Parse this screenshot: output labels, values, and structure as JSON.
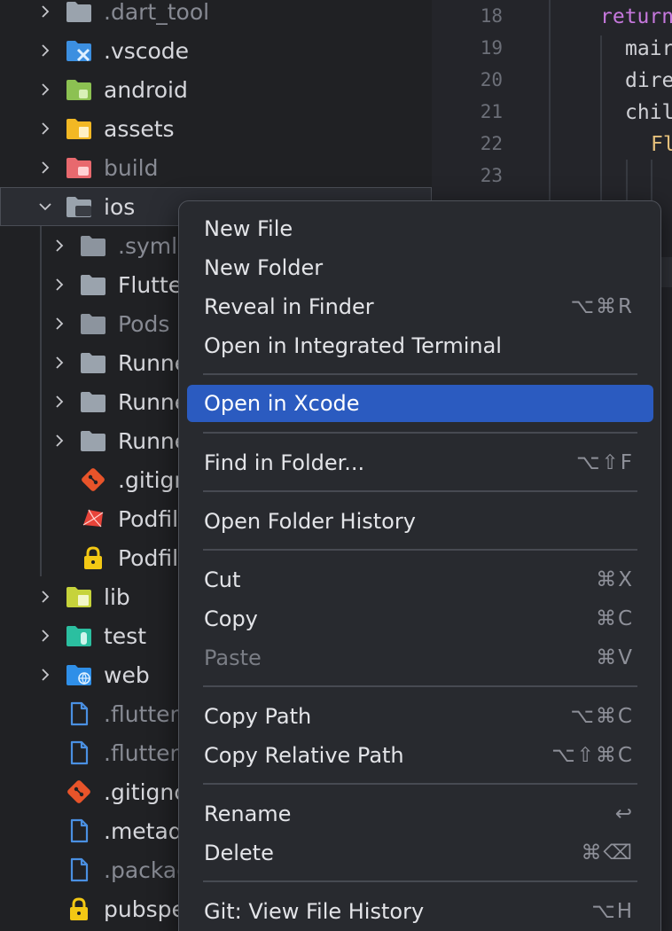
{
  "explorer": {
    "items": [
      {
        "label": ".dart_tool",
        "icon": "folder-icon",
        "expandable": true,
        "dim": true
      },
      {
        "label": ".vscode",
        "icon": "folder-vscode-icon",
        "expandable": true,
        "dim": false
      },
      {
        "label": "android",
        "icon": "folder-android-icon",
        "expandable": true,
        "dim": false
      },
      {
        "label": "assets",
        "icon": "folder-assets-icon",
        "expandable": true,
        "dim": false
      },
      {
        "label": "build",
        "icon": "folder-build-icon",
        "expandable": true,
        "dim": true
      },
      {
        "label": "ios",
        "icon": "folder-ios-icon",
        "expandable": true,
        "expanded": true,
        "dim": false
      },
      {
        "label": ".symli",
        "icon": "folder-icon",
        "expandable": true,
        "dim": true
      },
      {
        "label": "Flutte",
        "icon": "folder-icon",
        "expandable": true,
        "dim": false
      },
      {
        "label": "Pods",
        "icon": "folder-icon",
        "expandable": true,
        "dim": true
      },
      {
        "label": "Runne",
        "icon": "folder-icon",
        "expandable": true,
        "dim": false
      },
      {
        "label": "Runne",
        "icon": "folder-icon",
        "expandable": true,
        "dim": false
      },
      {
        "label": "Runne",
        "icon": "folder-icon",
        "expandable": true,
        "dim": false
      },
      {
        "label": ".gitign",
        "icon": "git-icon",
        "expandable": false,
        "dim": false
      },
      {
        "label": "Podfil",
        "icon": "ruby-icon",
        "expandable": false,
        "dim": false
      },
      {
        "label": "Podfil",
        "icon": "lock-icon",
        "expandable": false,
        "dim": false
      },
      {
        "label": "lib",
        "icon": "folder-lib-icon",
        "expandable": true,
        "dim": false
      },
      {
        "label": "test",
        "icon": "folder-test-icon",
        "expandable": true,
        "dim": false
      },
      {
        "label": "web",
        "icon": "folder-web-icon",
        "expandable": true,
        "dim": false
      },
      {
        "label": ".flutter-",
        "icon": "file-icon",
        "expandable": false,
        "dim": true
      },
      {
        "label": ".flutter-",
        "icon": "file-icon",
        "expandable": false,
        "dim": true
      },
      {
        "label": ".gitignc",
        "icon": "git-icon",
        "expandable": false,
        "dim": false
      },
      {
        "label": ".metad",
        "icon": "file-icon",
        "expandable": false,
        "dim": false
      },
      {
        "label": ".packag",
        "icon": "file-icon",
        "expandable": false,
        "dim": true
      },
      {
        "label": "pubspe",
        "icon": "lock-icon",
        "expandable": false,
        "dim": false
      }
    ]
  },
  "editor": {
    "line_numbers": [
      "18",
      "19",
      "20",
      "21",
      "22",
      "23"
    ],
    "lines": [
      {
        "text": "return",
        "kind": "keyword"
      },
      {
        "text": "mair",
        "kind": "plain"
      },
      {
        "text": "dire",
        "kind": "plain"
      },
      {
        "text": "chil",
        "kind": "plain"
      },
      {
        "text": "Fl",
        "kind": "type"
      }
    ]
  },
  "context_menu": {
    "items": [
      {
        "label": "New File",
        "shortcut": ""
      },
      {
        "label": "New Folder",
        "shortcut": ""
      },
      {
        "label": "Reveal in Finder",
        "shortcut": "⌥⌘R"
      },
      {
        "label": "Open in Integrated Terminal",
        "shortcut": ""
      },
      {
        "label": "Open in Xcode",
        "shortcut": "",
        "highlighted": true
      },
      {
        "label": "Find in Folder...",
        "shortcut": "⌥⇧F"
      },
      {
        "label": "Open Folder History",
        "shortcut": ""
      },
      {
        "label": "Cut",
        "shortcut": "⌘X"
      },
      {
        "label": "Copy",
        "shortcut": "⌘C"
      },
      {
        "label": "Paste",
        "shortcut": "⌘V",
        "disabled": true
      },
      {
        "label": "Copy Path",
        "shortcut": "⌥⌘C"
      },
      {
        "label": "Copy Relative Path",
        "shortcut": "⌥⇧⌘C"
      },
      {
        "label": "Rename",
        "shortcut": "↩"
      },
      {
        "label": "Delete",
        "shortcut": "⌘⌫"
      },
      {
        "label": "Git: View File History",
        "shortcut": "⌥H"
      }
    ]
  },
  "colors": {
    "highlight": "#2b5bc0",
    "folder": "#9aa3ad",
    "vscode": "#3c8fe0",
    "android": "#8cc152",
    "assets": "#f2b824",
    "build": "#e8696e",
    "lib": "#c6d33b",
    "test": "#2bbfa0",
    "web": "#2f8fe8",
    "git": "#e8542a",
    "lock": "#f3c814",
    "file": "#4a90e2"
  }
}
